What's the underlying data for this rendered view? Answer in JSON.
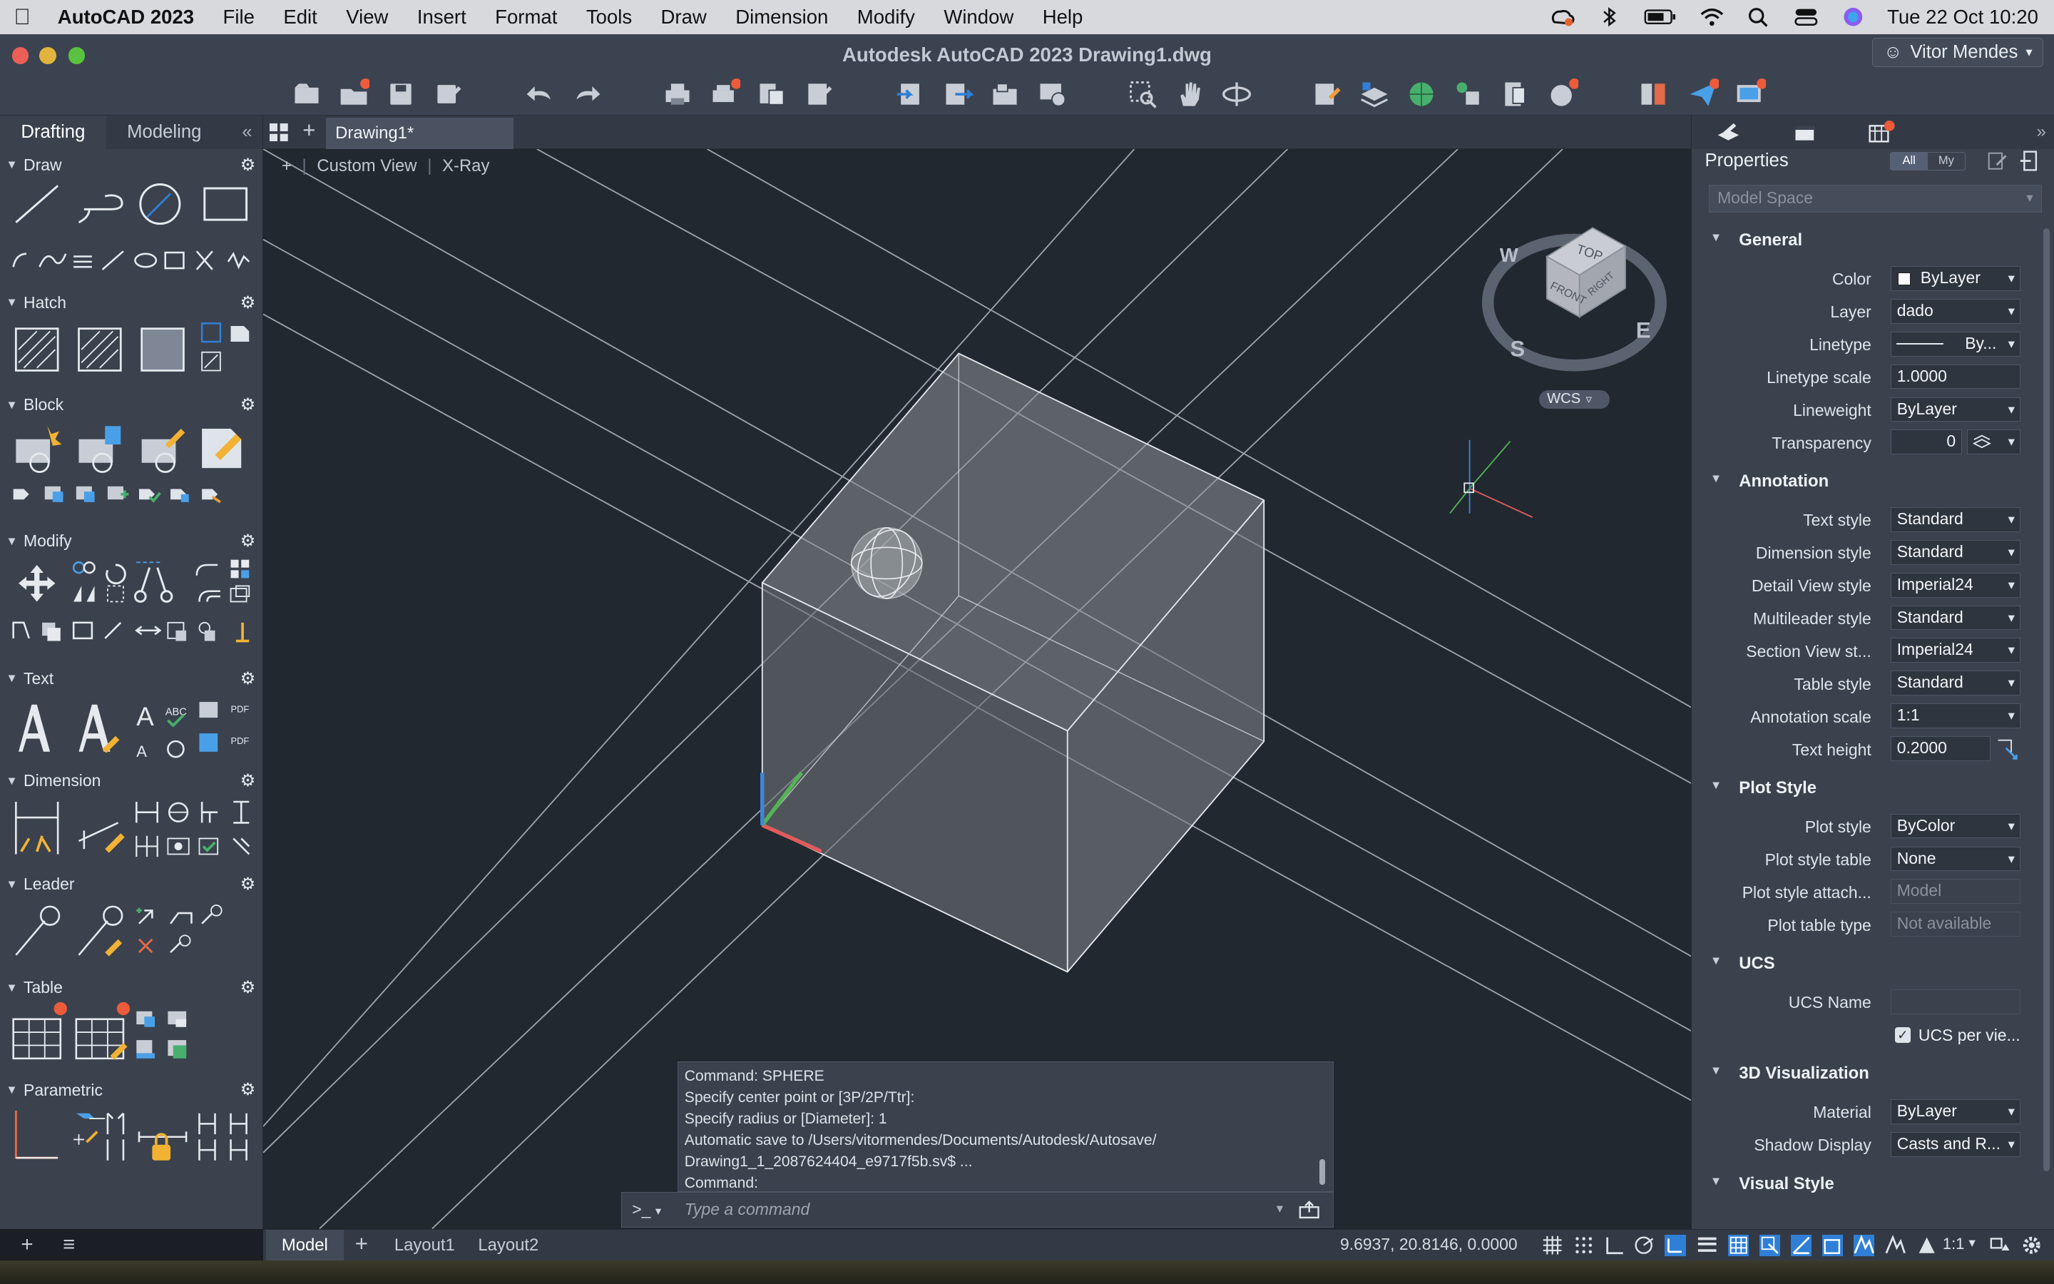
{
  "menubar": {
    "app_name": "AutoCAD 2023",
    "items": [
      "File",
      "Edit",
      "View",
      "Insert",
      "Format",
      "Tools",
      "Draw",
      "Dimension",
      "Modify",
      "Window",
      "Help"
    ],
    "clock": "Tue 22 Oct  10:20"
  },
  "window": {
    "title": "Autodesk AutoCAD 2023    Drawing1.dwg",
    "user": "Vitor Mendes"
  },
  "palette": {
    "tabs": [
      "Drafting",
      "Modeling"
    ],
    "sections": {
      "draw": "Draw",
      "hatch": "Hatch",
      "block": "Block",
      "modify": "Modify",
      "text": "Text",
      "dimension": "Dimension",
      "leader": "Leader",
      "table": "Table",
      "parametric": "Parametric"
    }
  },
  "document": {
    "tab": "Drawing1*",
    "view_label": "Custom View",
    "visual_style": "X-Ray"
  },
  "viewcube": {
    "top": "TOP",
    "front": "FRONT",
    "right": "RIGHT",
    "compass_w": "W",
    "compass_s": "S",
    "compass_e": "E",
    "wcs": "WCS"
  },
  "command": {
    "history": [
      "Command: SPHERE",
      "Specify center point or [3P/2P/Ttr]:",
      "Specify radius or [Diameter]: 1",
      "Automatic save to /Users/vitormendes/Documents/Autodesk/Autosave/",
      "Drawing1_1_2087624404_e9717f5b.sv$ ...",
      "Command:"
    ],
    "prompt": ">_",
    "placeholder": "Type a command"
  },
  "status": {
    "layouts": [
      "Model",
      "Layout1",
      "Layout2"
    ],
    "coords": "9.6937,    20.8146, 0.0000",
    "scale": "1:1"
  },
  "properties": {
    "title": "Properties",
    "filter_all": "All",
    "filter_my": "My",
    "selection": "Model Space",
    "general": {
      "header": "General",
      "rows": [
        {
          "label": "Color",
          "value": "ByLayer"
        },
        {
          "label": "Layer",
          "value": "dado"
        },
        {
          "label": "Linetype",
          "value": "By..."
        },
        {
          "label": "Linetype scale",
          "value": "1.0000"
        },
        {
          "label": "Lineweight",
          "value": "ByLayer"
        },
        {
          "label": "Transparency",
          "value": "0"
        }
      ]
    },
    "annotation": {
      "header": "Annotation",
      "rows": [
        {
          "label": "Text style",
          "value": "Standard"
        },
        {
          "label": "Dimension style",
          "value": "Standard"
        },
        {
          "label": "Detail View style",
          "value": "Imperial24"
        },
        {
          "label": "Multileader style",
          "value": "Standard"
        },
        {
          "label": "Section View st...",
          "value": "Imperial24"
        },
        {
          "label": "Table style",
          "value": "Standard"
        },
        {
          "label": "Annotation scale",
          "value": "1:1"
        },
        {
          "label": "Text height",
          "value": "0.2000"
        }
      ]
    },
    "plot_style": {
      "header": "Plot Style",
      "rows": [
        {
          "label": "Plot style",
          "value": "ByColor"
        },
        {
          "label": "Plot style table",
          "value": "None"
        },
        {
          "label": "Plot style attach...",
          "value": "Model"
        },
        {
          "label": "Plot table type",
          "value": "Not available"
        }
      ]
    },
    "ucs": {
      "header": "UCS",
      "rows": [
        {
          "label": "UCS Name",
          "value": ""
        },
        {
          "label": "UCS per vie...",
          "value": ""
        }
      ]
    },
    "visualization": {
      "header": "3D Visualization",
      "rows": [
        {
          "label": "Material",
          "value": "ByLayer"
        },
        {
          "label": "Shadow Display",
          "value": "Casts and R..."
        }
      ]
    },
    "visual_style": {
      "header": "Visual Style"
    }
  },
  "colors": {
    "accent": "#2f7fd6",
    "notification": "#ee5b3a",
    "viewport_bg": "#212830",
    "panel_bg": "#3b424e"
  }
}
